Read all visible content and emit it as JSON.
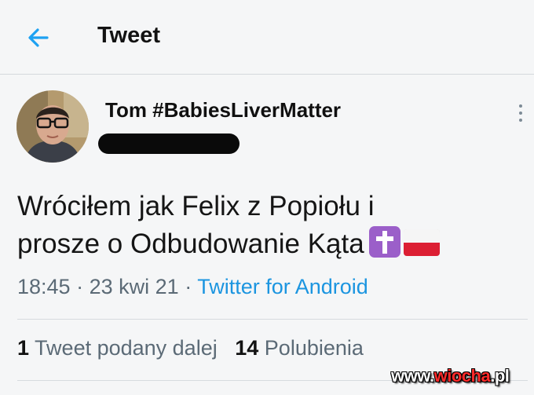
{
  "header": {
    "back_icon": "arrow-left-icon",
    "title": "Tweet",
    "accent_color": "#1da1f2"
  },
  "tweet": {
    "author_name": "Tom #BabiesLiverMatter",
    "text_line1": "Wróciłem jak Felix z Popiołu i",
    "text_line2": "prosze o Odbudowanie Kąta",
    "emojis": [
      "latin-cross-emoji",
      "poland-flag-emoji"
    ],
    "time": "18:45",
    "date": "23 kwi 21",
    "separator": "·",
    "source": "Twitter for Android",
    "retweets_count": "1",
    "retweets_label": "Tweet podany dalej",
    "likes_count": "14",
    "likes_label": "Polubienia",
    "more_icon": "more-vertical-icon"
  },
  "watermark": {
    "prefix": "www.",
    "brand": "wiocha",
    "suffix": ".pl"
  }
}
